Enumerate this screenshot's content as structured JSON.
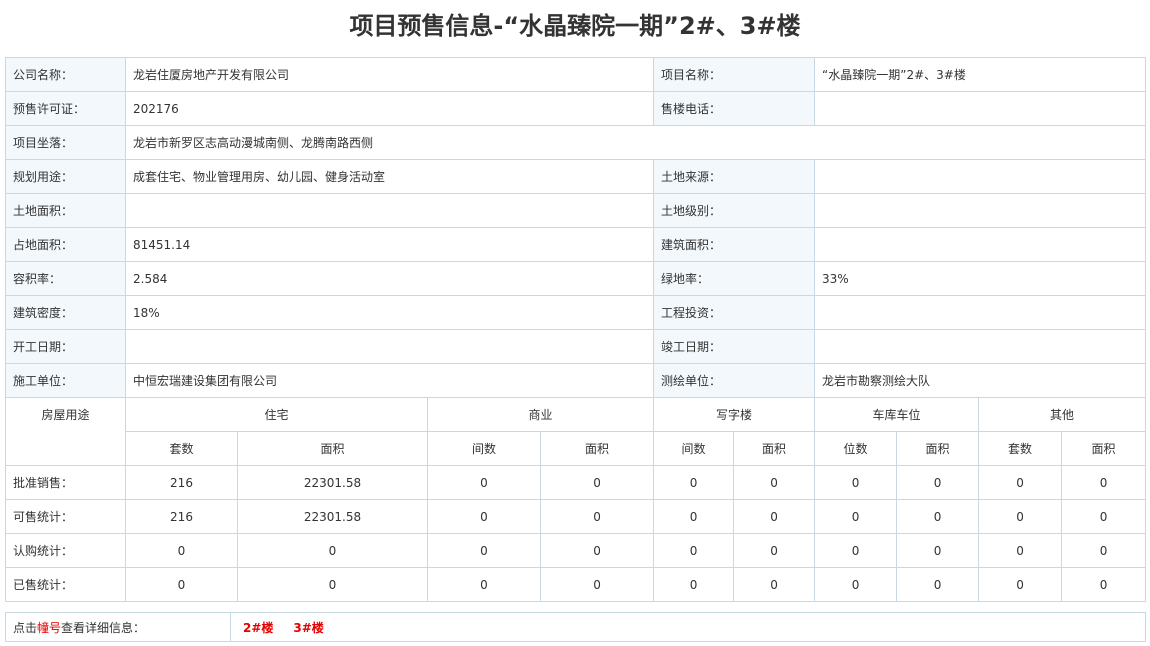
{
  "title": "项目预售信息-“水晶臻院一期”2#、3#楼",
  "info": {
    "company_label": "公司名称：",
    "company": "龙岩住厦房地产开发有限公司",
    "project_label": "项目名称：",
    "project": "“水晶臻院一期”2#、3#楼",
    "permit_label": "预售许可证：",
    "permit": "202176",
    "phone_label": "售楼电话：",
    "phone": "",
    "location_label": "项目坐落：",
    "location": "龙岩市新罗区志高动漫城南侧、龙腾南路西侧",
    "usage_label": "规划用途：",
    "usage": "成套住宅、物业管理用房、幼儿园、健身活动室",
    "land_source_label": "土地来源：",
    "land_source": "",
    "land_area_label": "土地面积：",
    "land_area": "",
    "land_grade_label": "土地级别：",
    "land_grade": "",
    "occupied_area_label": "占地面积：",
    "occupied_area": "81451.14",
    "building_area_label": "建筑面积：",
    "building_area": "",
    "far_label": "容积率：",
    "far": "2.584",
    "green_label": "绿地率：",
    "green": "33%",
    "density_label": "建筑密度：",
    "density": "18%",
    "investment_label": "工程投资：",
    "investment": "",
    "start_label": "开工日期：",
    "start": "",
    "complete_label": "竣工日期：",
    "complete": "",
    "contractor_label": "施工单位：",
    "contractor": "中恒宏瑞建设集团有限公司",
    "surveyor_label": "测绘单位：",
    "surveyor": "龙岩市勘察测绘大队"
  },
  "stats": {
    "usage_header": "房屋用途",
    "groups": [
      "住宅",
      "商业",
      "写字楼",
      "车库车位",
      "其他"
    ],
    "subheaders": [
      "套数",
      "面积",
      "间数",
      "面积",
      "间数",
      "面积",
      "位数",
      "面积",
      "套数",
      "面积"
    ],
    "rows": [
      {
        "label": "批准销售：",
        "values": [
          "216",
          "22301.58",
          "0",
          "0",
          "0",
          "0",
          "0",
          "0",
          "0",
          "0"
        ]
      },
      {
        "label": "可售统计：",
        "values": [
          "216",
          "22301.58",
          "0",
          "0",
          "0",
          "0",
          "0",
          "0",
          "0",
          "0"
        ]
      },
      {
        "label": "认购统计：",
        "values": [
          "0",
          "0",
          "0",
          "0",
          "0",
          "0",
          "0",
          "0",
          "0",
          "0"
        ]
      },
      {
        "label": "已售统计：",
        "values": [
          "0",
          "0",
          "0",
          "0",
          "0",
          "0",
          "0",
          "0",
          "0",
          "0"
        ]
      }
    ]
  },
  "footer": {
    "prefix": "点击",
    "highlight": "幢号",
    "suffix": "查看详细信息：",
    "buildings": [
      "2#楼",
      "3#楼"
    ]
  },
  "colors": {
    "border": "#c8d9e3",
    "label_bg": "#f3f8fc",
    "accent": "#e60000",
    "text": "#333333"
  }
}
